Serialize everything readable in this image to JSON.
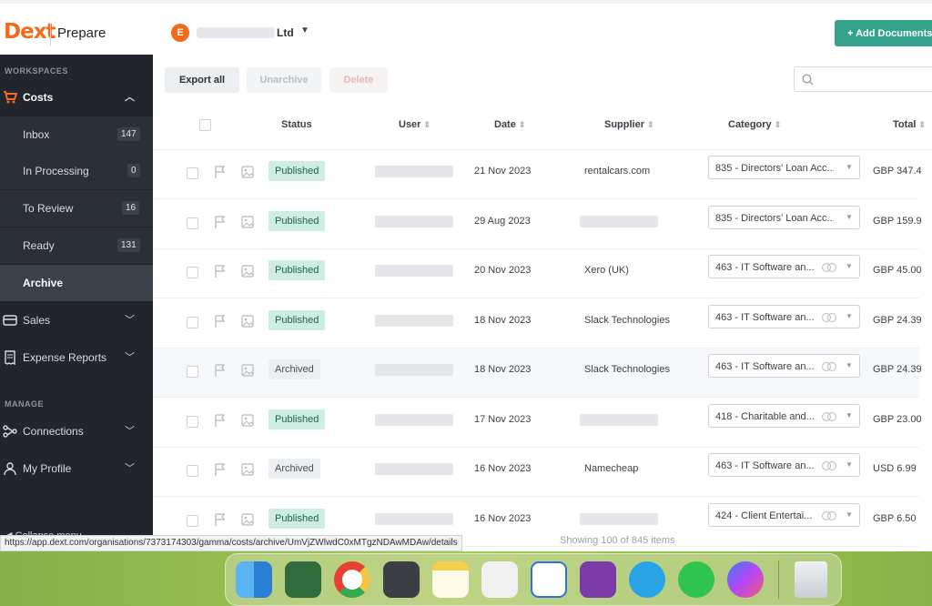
{
  "header": {
    "logo": "Dext",
    "app_name": "Prepare",
    "org_initial": "E",
    "org_suffix": "Ltd",
    "add_documents": "+ Add Documents"
  },
  "sidebar": {
    "workspaces_label": "WORKSPACES",
    "costs_label": "Costs",
    "items": [
      {
        "label": "Inbox",
        "count": "147"
      },
      {
        "label": "In Processing",
        "count": "0"
      },
      {
        "label": "To Review",
        "count": "16"
      },
      {
        "label": "Ready",
        "count": "131"
      },
      {
        "label": "Archive",
        "count": ""
      }
    ],
    "sales_label": "Sales",
    "expense_label": "Expense Reports",
    "manage_label": "MANAGE",
    "connections_label": "Connections",
    "profile_label": "My Profile",
    "collapse_label": "Collapse menu"
  },
  "toolbar": {
    "export_all": "Export all",
    "unarchive": "Unarchive",
    "delete": "Delete"
  },
  "table": {
    "headers": {
      "status": "Status",
      "user": "User",
      "date": "Date",
      "supplier": "Supplier",
      "category": "Category",
      "total": "Total"
    },
    "rows": [
      {
        "status": "Published",
        "date": "21 Nov 2023",
        "supplier": "rentalcars.com",
        "category": "835 - Directors' Loan Acc...",
        "total": "GBP 347.4"
      },
      {
        "status": "Published",
        "date": "29 Aug 2023",
        "supplier": "",
        "category": "835 - Directors' Loan Acc...",
        "total": "GBP 159.9"
      },
      {
        "status": "Published",
        "date": "20 Nov 2023",
        "supplier": "Xero (UK)",
        "category": "463 - IT Software an...",
        "total": "GBP 45.00"
      },
      {
        "status": "Published",
        "date": "18 Nov 2023",
        "supplier": "Slack Technologies",
        "category": "463 - IT Software an...",
        "total": "GBP 24.39"
      },
      {
        "status": "Archived",
        "date": "18 Nov 2023",
        "supplier": "Slack Technologies",
        "category": "463 - IT Software an...",
        "total": "GBP 24.39"
      },
      {
        "status": "Published",
        "date": "17 Nov 2023",
        "supplier": "",
        "category": "418 - Charitable and...",
        "total": "GBP 23.00"
      },
      {
        "status": "Archived",
        "date": "16 Nov 2023",
        "supplier": "Namecheap",
        "category": "463 - IT Software an...",
        "total": "USD 6.99"
      },
      {
        "status": "Published",
        "date": "16 Nov 2023",
        "supplier": "",
        "category": "424 - Client Entertai...",
        "total": "GBP 6.50"
      }
    ]
  },
  "footer": {
    "showing": "Showing 100 of 845 items",
    "url": "https://app.dext.com/organisations/7373174303/gamma/costs/archive/UmVjZWlwdC0xMTgzNDAwMDAw/details"
  },
  "colors": {
    "accent": "#36a38c",
    "brand": "#f26b1d",
    "sidebar": "#22262c",
    "published_badge": "#cfeee3"
  }
}
